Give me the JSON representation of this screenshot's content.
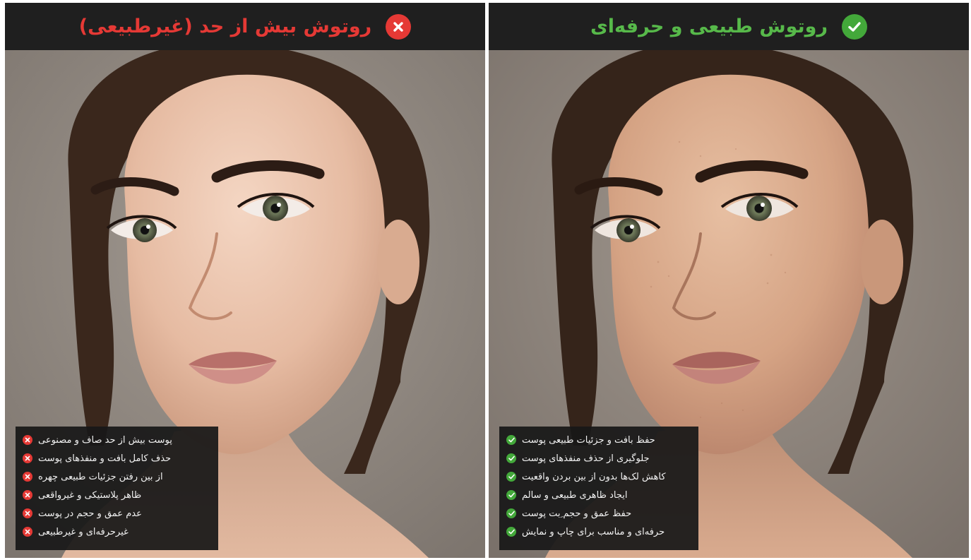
{
  "panels": {
    "bad": {
      "title": "روتوش بیش از حد (غیرطبیعی)",
      "badge_icon": "x-circle-icon",
      "accent": "#e53935",
      "items": [
        "پوست بیش از حد صاف و مصنوعی",
        "حذف کامل بافت و منفذهای پوست",
        "از بین رفتن جزئیات طبیعی چهره",
        "ظاهر پلاستیکی و غیرواقعی",
        "عدم عمق و حجم در پوست",
        "غیرحرفه‌ای و غیرطبیعی"
      ]
    },
    "good": {
      "title": "روتوش طبیعی و حرفه‌ای",
      "badge_icon": "check-circle-icon",
      "accent": "#43a83a",
      "items": [
        "حفظ بافت و جزئیات طبیعی پوست",
        "جلوگیری از حذف منفذهای پوست",
        "کاهش لک‌ها بدون از بین بردن واقعیت",
        "ایجاد ظاهری طبیعی و سالم",
        "حفظ عمق و حجم ِبت پوست",
        "حرفه‌ای و مناسب برای چاپ و نمایش"
      ]
    }
  },
  "colors": {
    "header_bg": "#1f1f1f",
    "overlay_bg": "#181818",
    "backdrop": "#8f8780"
  }
}
